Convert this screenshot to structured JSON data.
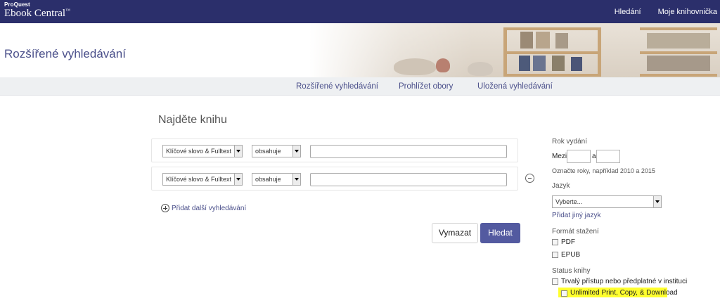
{
  "brand": {
    "small": "ProQuest",
    "big": "Ebook Central",
    "tm": "™"
  },
  "topnav": {
    "search": "Hledání",
    "my_library": "Moje knihovnička"
  },
  "page": {
    "title": "Rozšířené vyhledávání"
  },
  "subnav": {
    "advanced": "Rozšířené vyhledávání",
    "browse": "Prohlížet obory",
    "saved": "Uložená vyhledávání"
  },
  "form": {
    "heading": "Najděte knihu",
    "rows": [
      {
        "field": "Klíčové slovo & Fulltext",
        "operator": "obsahuje",
        "value": ""
      },
      {
        "field": "Klíčové slovo & Fulltext",
        "operator": "obsahuje",
        "value": ""
      }
    ],
    "add_search": "Přidat další vyhledávání",
    "clear_label": "Vymazat",
    "search_label": "Hledat"
  },
  "filters": {
    "year": {
      "label": "Rok vydání",
      "from_label": "Mezi",
      "and_label": "a",
      "hint": "Označte roky, například 2010 a 2015"
    },
    "language": {
      "label": "Jazyk",
      "placeholder": "Vyberte...",
      "add_link": "Přidat jiný jazyk"
    },
    "format": {
      "label": "Formát stažení",
      "options": [
        "PDF",
        "EPUB"
      ]
    },
    "status": {
      "label": "Status knihy",
      "options": [
        "Trvalý přístup nebo předplatné v instituci",
        "Unlimited Print, Copy, & Download"
      ]
    }
  },
  "colors": {
    "topbar": "#2b2f6b",
    "accent": "#535aa0",
    "link": "#4a4f8a",
    "highlight": "#ffff2e"
  }
}
